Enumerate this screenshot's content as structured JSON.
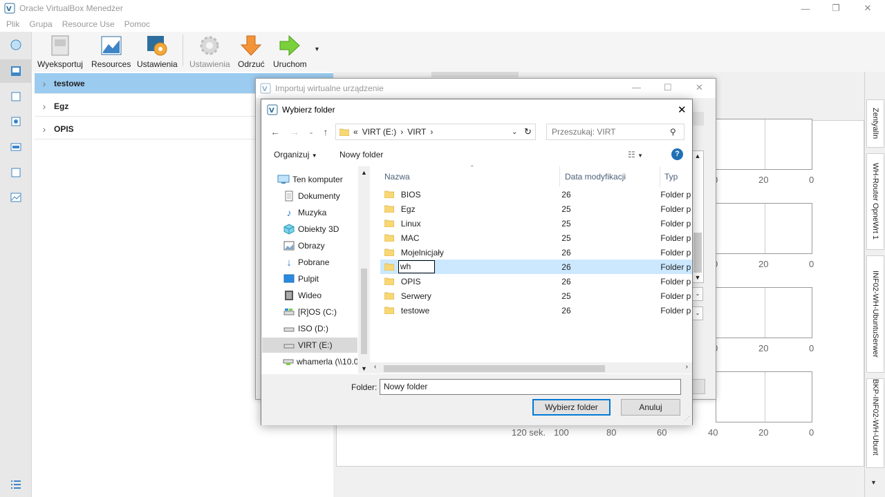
{
  "app": {
    "title": "Oracle VirtualBox Menedżer",
    "menu": [
      "Plik",
      "Grupa",
      "Resource Use",
      "Pomoc"
    ]
  },
  "toolbar": {
    "export": "Wyeksportuj",
    "resources": "Resources",
    "preferences": "Ustawienia",
    "settings": "Ustawienia",
    "discard": "Odrzuć",
    "start": "Uruchom"
  },
  "groups": [
    {
      "name": "testowe",
      "selected": true
    },
    {
      "name": "Egz",
      "selected": false
    },
    {
      "name": "OPIS",
      "selected": false
    }
  ],
  "graphs": {
    "axis_rows": [
      [
        "0",
        "20",
        "0"
      ],
      [
        "0",
        "20",
        "0"
      ],
      [
        "0",
        "20",
        "0"
      ]
    ],
    "bottom_axis": [
      "120 sek.",
      "100",
      "80",
      "60",
      "40",
      "20",
      "0"
    ]
  },
  "right_tabs": [
    "ZentyalIn",
    "WH-Router OpneWrt 1",
    "INF02-WH-UbuntuSerwer",
    "BKP-INF02-WH-Ubunt"
  ],
  "import_dialog": {
    "title": "Importuj wirtualne urządzenie"
  },
  "folder_dialog": {
    "title": "Wybierz folder",
    "address": {
      "prefix": "«",
      "drive": "VIRT (E:)",
      "folder": "VIRT"
    },
    "search_placeholder": "Przeszukaj: VIRT",
    "organize": "Organizuj",
    "new_folder": "Nowy folder",
    "columns": {
      "name": "Nazwa",
      "date": "Data modyfikacji",
      "type": "Typ"
    },
    "tree": [
      {
        "label": "Ten komputer",
        "icon": "computer-icon"
      },
      {
        "label": "Dokumenty",
        "icon": "documents-icon"
      },
      {
        "label": "Muzyka",
        "icon": "music-icon"
      },
      {
        "label": "Obiekty 3D",
        "icon": "3d-objects-icon"
      },
      {
        "label": "Obrazy",
        "icon": "pictures-icon"
      },
      {
        "label": "Pobrane",
        "icon": "downloads-icon"
      },
      {
        "label": "Pulpit",
        "icon": "desktop-icon"
      },
      {
        "label": "Wideo",
        "icon": "video-icon"
      },
      {
        "label": "[R]OS (C:)",
        "icon": "drive-icon"
      },
      {
        "label": "ISO (D:)",
        "icon": "drive-icon"
      },
      {
        "label": "VIRT (E:)",
        "icon": "drive-icon",
        "selected": true
      },
      {
        "label": "whamerla (\\\\10.0",
        "icon": "network-drive-icon"
      }
    ],
    "files": [
      {
        "name": "BIOS",
        "date": "26",
        "type": "Folder p"
      },
      {
        "name": "Egz",
        "date": "25",
        "type": "Folder p"
      },
      {
        "name": "Linux",
        "date": "25",
        "type": "Folder p"
      },
      {
        "name": "MAC",
        "date": "25",
        "type": "Folder p"
      },
      {
        "name": "Mojelnicjały",
        "date": "26",
        "type": "Folder p"
      },
      {
        "name": "wh",
        "date": "26",
        "type": "Folder p",
        "selected": true,
        "editing": true
      },
      {
        "name": "OPIS",
        "date": "26",
        "type": "Folder p"
      },
      {
        "name": "Serwery",
        "date": "25",
        "type": "Folder p"
      },
      {
        "name": "testowe",
        "date": "26",
        "type": "Folder p"
      }
    ],
    "folder_label": "Folder:",
    "folder_value": "Nowy folder",
    "select_button": "Wybierz folder",
    "cancel_button": "Anuluj"
  },
  "colors": {
    "selection": "#9ccbf0",
    "file_selection": "#cce8ff",
    "accent": "#0078d7",
    "folder": "#f8d775"
  }
}
